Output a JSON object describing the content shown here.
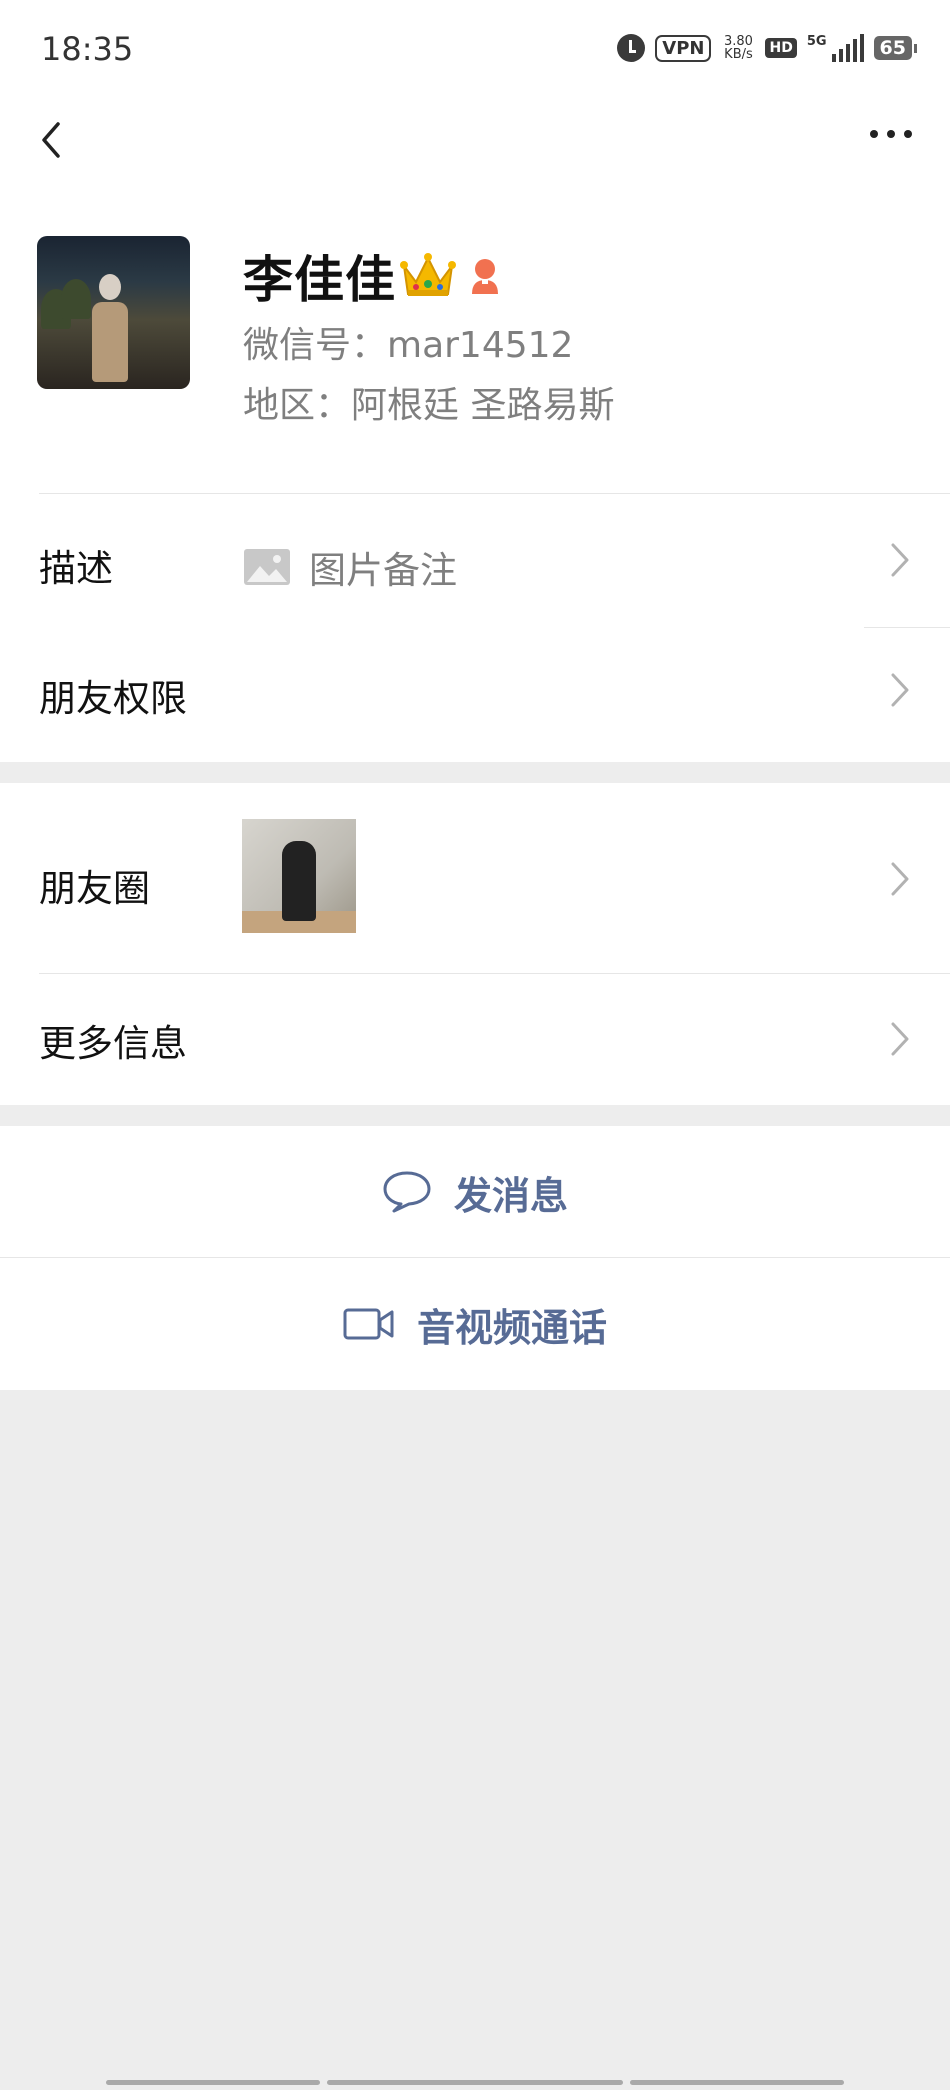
{
  "status_bar": {
    "time": "18:35",
    "vpn": "VPN",
    "speed_value": "3.80",
    "speed_unit": "KB/s",
    "hd": "HD",
    "network": "5G",
    "battery": "65"
  },
  "nav": {
    "back_icon": "chevron-left-icon",
    "more_icon": "more-dots-icon"
  },
  "profile": {
    "name": "李佳佳",
    "wechat_id": "微信号：mar14512",
    "region": "地区：阿根廷  圣路易斯",
    "badges": [
      "crown-icon",
      "female-gender-icon"
    ]
  },
  "settings": {
    "description_label": "描述",
    "description_value": "图片备注",
    "permissions_label": "朋友权限",
    "moments_label": "朋友圈",
    "more_info_label": "更多信息"
  },
  "actions": {
    "send_message": "发消息",
    "video_call": "音视频通话"
  },
  "colors": {
    "action_blue": "#576b95",
    "background_gray": "#ededed",
    "secondary_text": "#7f7f7f"
  }
}
